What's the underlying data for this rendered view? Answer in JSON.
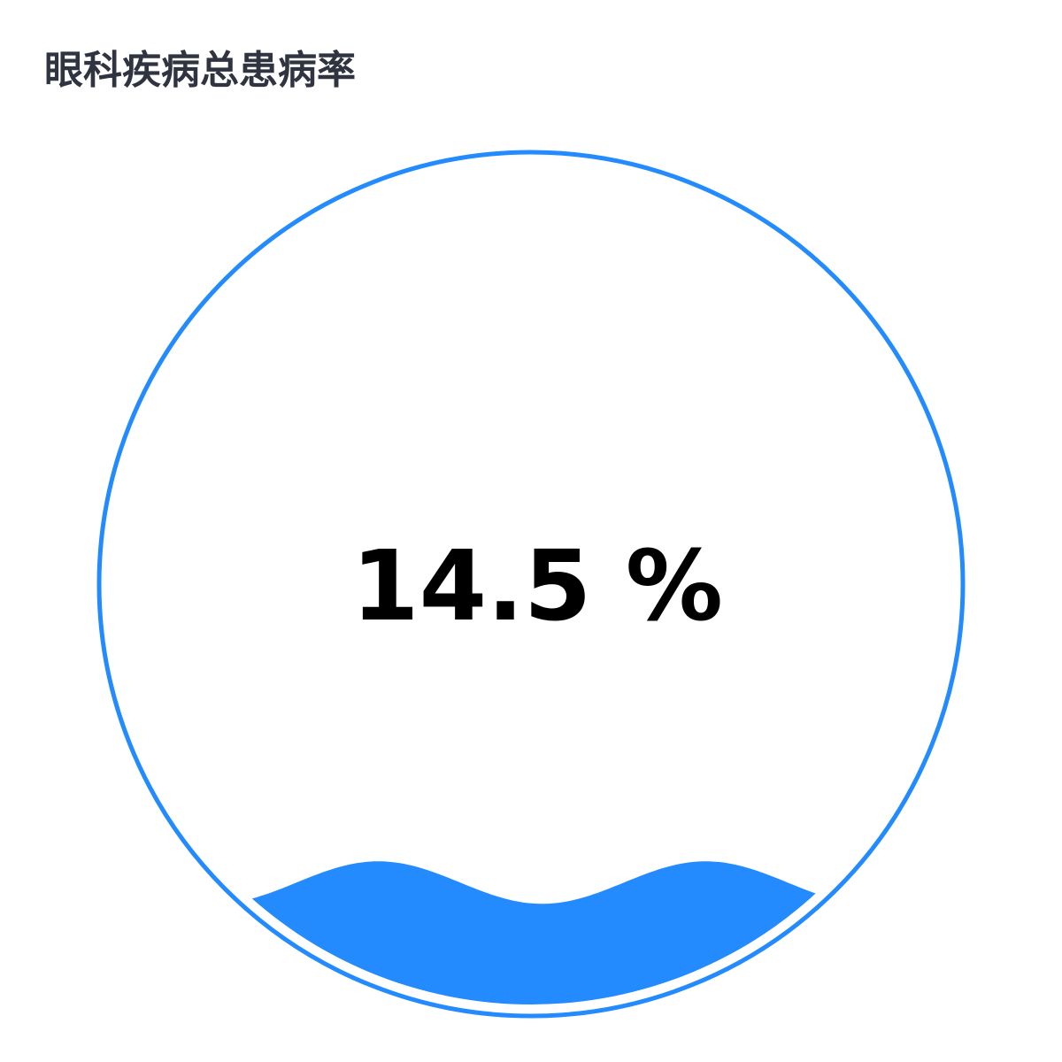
{
  "chart_data": {
    "type": "liquidfill",
    "title": "眼科疾病总患病率",
    "value": 14.5,
    "value_label": "14.5 %",
    "unit": "%",
    "max": 100
  },
  "colors": {
    "primary": "#248bff",
    "title": "#2f3440",
    "label": "#000000",
    "background": "#ffffff"
  }
}
